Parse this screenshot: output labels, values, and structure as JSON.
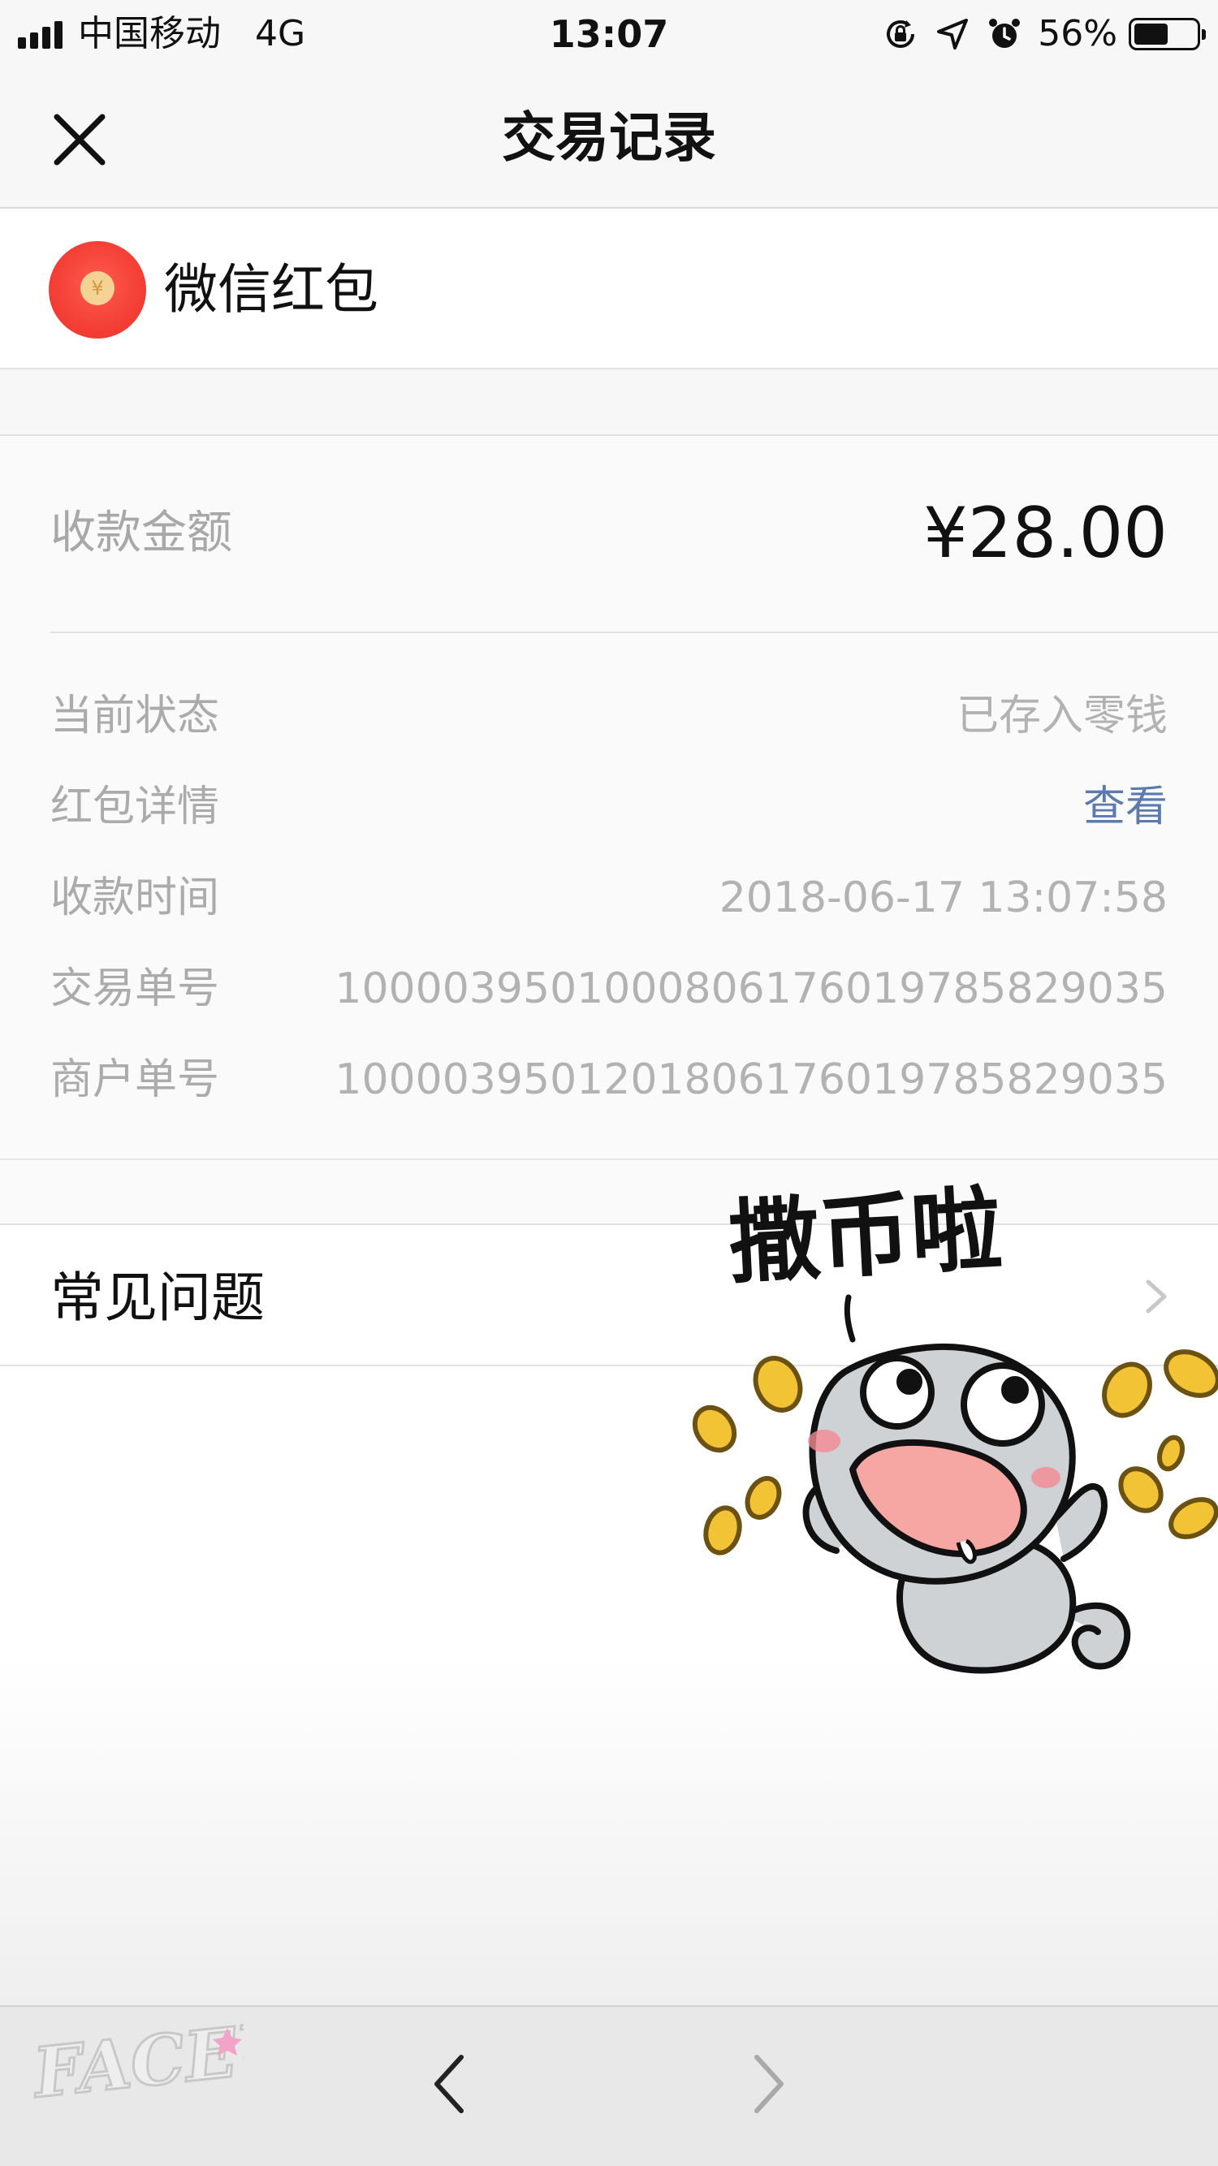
{
  "status_bar": {
    "carrier": "中国移动",
    "network": "4G",
    "time": "13:07",
    "battery_percent": "56%",
    "battery_level": 0.56,
    "icons": [
      "signal-icon",
      "rotation-lock-icon",
      "location-arrow-icon",
      "alarm-icon",
      "battery-icon"
    ]
  },
  "nav": {
    "title": "交易记录",
    "close_icon": "close-icon"
  },
  "merchant": {
    "name": "微信红包",
    "icon": "red-packet-icon",
    "coin_symbol": "¥"
  },
  "amount": {
    "label": "收款金额",
    "value": "¥28.00"
  },
  "details": [
    {
      "label": "当前状态",
      "value": "已存入零钱",
      "is_link": false
    },
    {
      "label": "红包详情",
      "value": "查看",
      "is_link": true
    },
    {
      "label": "收款时间",
      "value": "2018-06-17 13:07:58",
      "is_link": false
    },
    {
      "label": "交易单号",
      "value": "100003950100080617601978582903​5",
      "is_link": false
    },
    {
      "label": "商户单号",
      "value": "1000039501201806176019785829035",
      "is_link": false
    }
  ],
  "faq": {
    "label": "常见问题",
    "icon": "chevron-right-icon"
  },
  "sticker": {
    "text": "撒币啦",
    "icon": "coin-sticker-icon"
  },
  "toolbar": {
    "back_icon": "chevron-left-icon",
    "forward_icon": "chevron-right-icon"
  },
  "watermark": {
    "text": "FACEU"
  },
  "colors": {
    "bar_background": "#f7f7f7",
    "label_gray": "#ababab",
    "link_blue": "#5b7ab0",
    "red_packet": "#f23b32",
    "coin_gold": "#f2c335"
  }
}
